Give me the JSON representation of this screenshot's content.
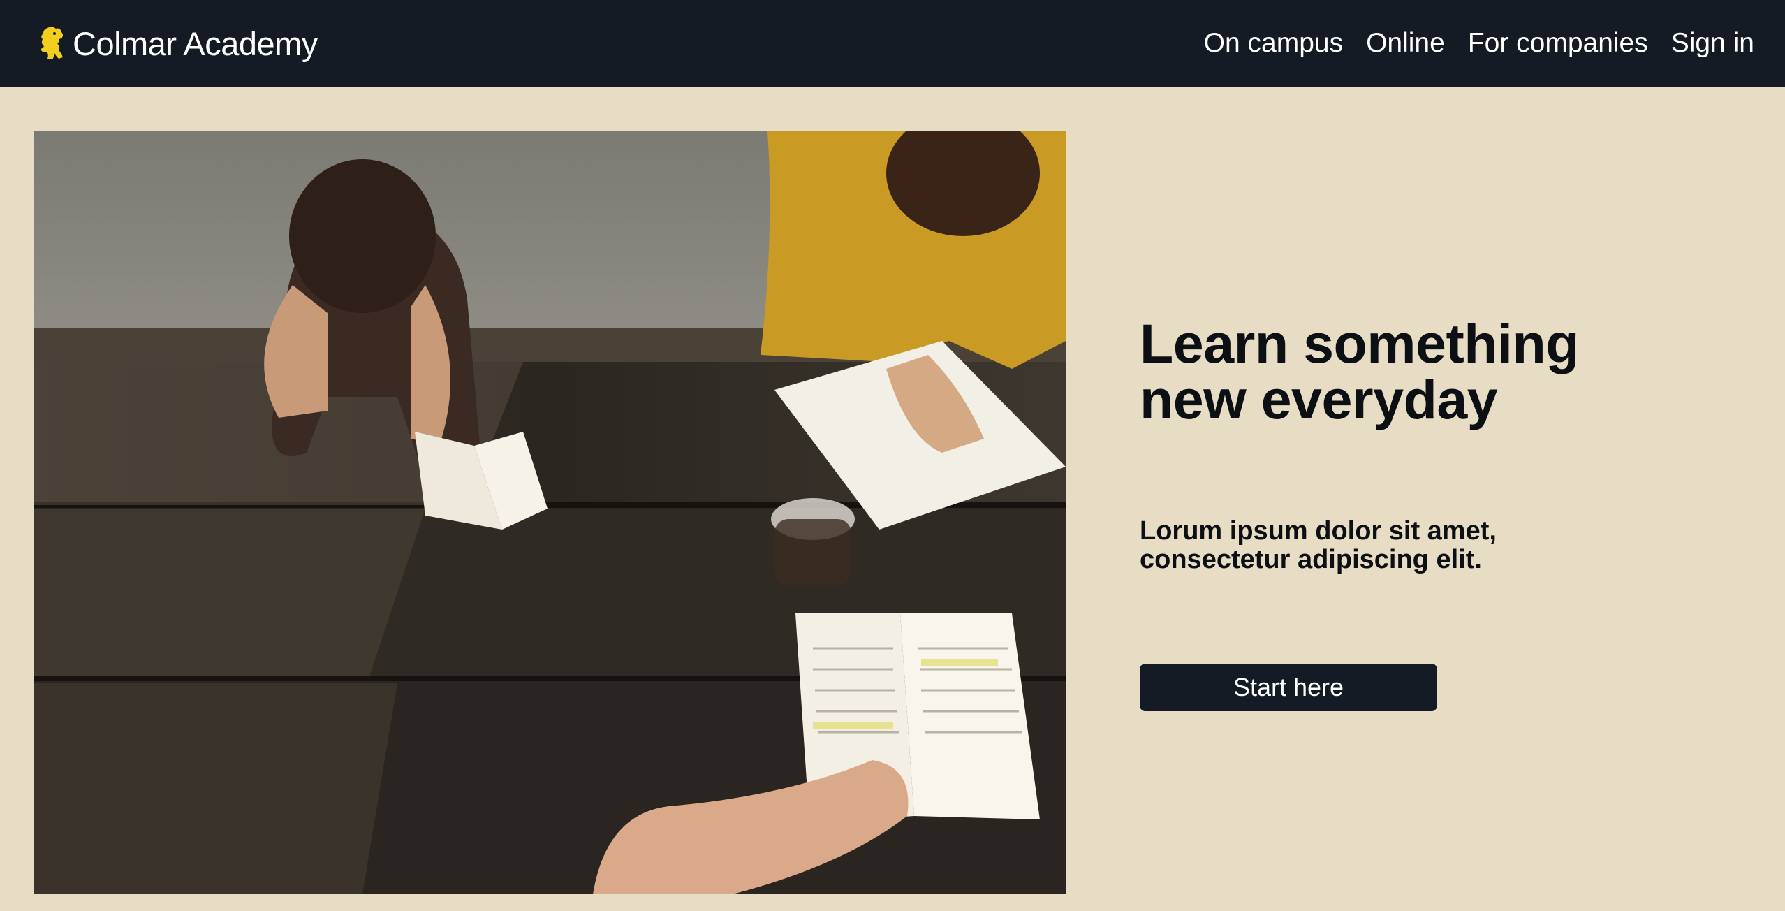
{
  "navbar": {
    "brand_name": "Colmar Academy",
    "links": [
      {
        "label": "On campus"
      },
      {
        "label": "Online"
      },
      {
        "label": "For companies"
      },
      {
        "label": "Sign in"
      }
    ]
  },
  "hero": {
    "title_line1": "Learn something",
    "title_line2": "new everyday",
    "subtitle_line1": "Lorum ipsum dolor sit amet,",
    "subtitle_line2": "consectetur adipiscing elit.",
    "cta_label": "Start here",
    "image_alt": "Students studying at a wooden table"
  },
  "colors": {
    "navbar_bg": "#141b24",
    "page_bg": "#e6ddc4",
    "brand_logo": "#f2cf1f",
    "text_dark": "#0c0f14",
    "button_bg": "#141b24",
    "button_text": "#ffffff"
  }
}
